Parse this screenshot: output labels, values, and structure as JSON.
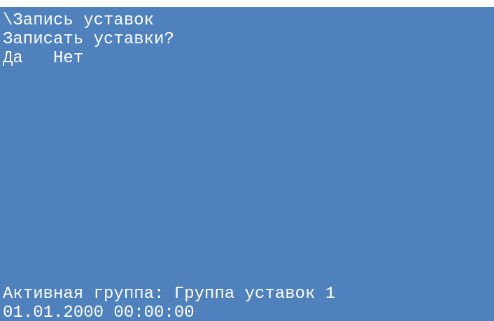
{
  "screen": {
    "title": "\\Запись уставок",
    "question": "Записать уставки?",
    "options": {
      "yes": "Да",
      "no": "Нет"
    },
    "status": "Активная группа: Группа уставок 1",
    "datetime": "01.01.2000 00:00:00"
  },
  "colors": {
    "background": "#4f81bd",
    "text": "#ffffff"
  }
}
